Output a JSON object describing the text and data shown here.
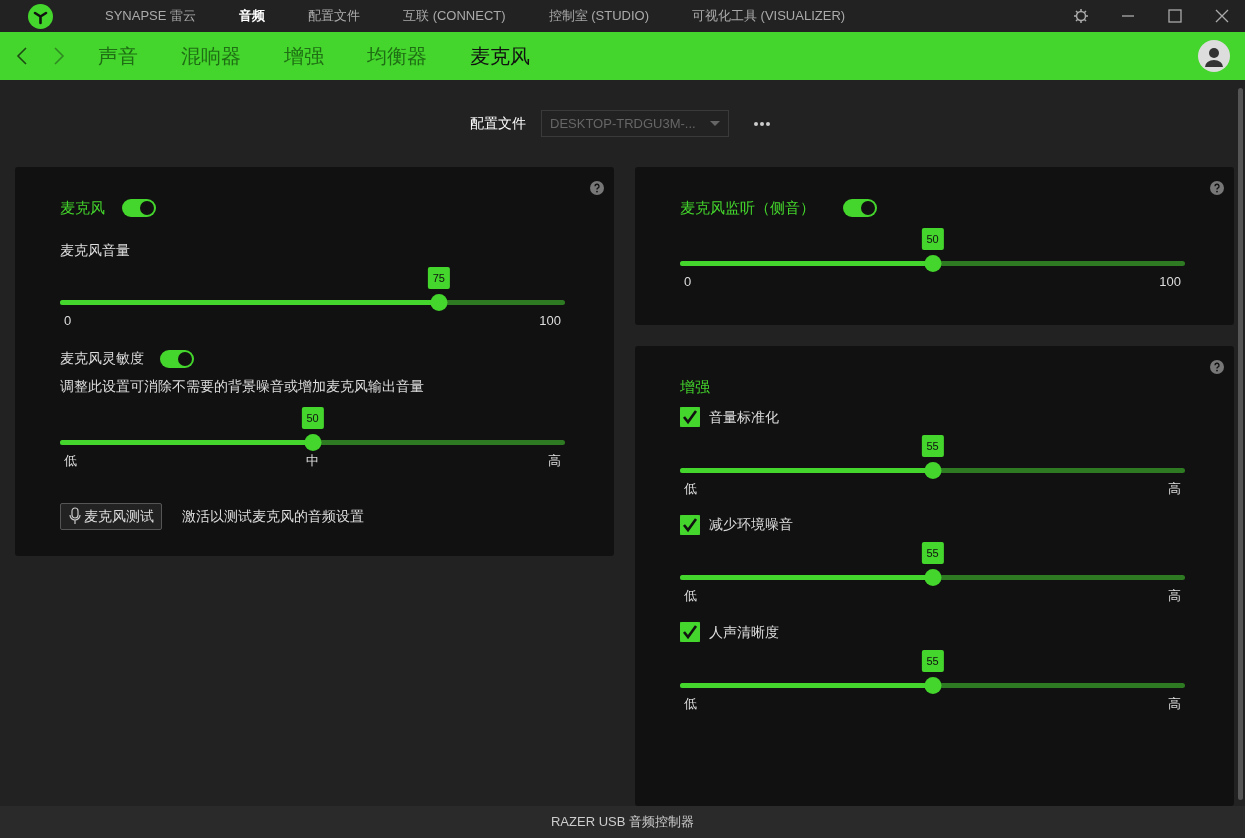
{
  "top_nav": [
    {
      "label": "SYNAPSE 雷云",
      "selected": false
    },
    {
      "label": "音频",
      "selected": true
    },
    {
      "label": "配置文件",
      "selected": false
    },
    {
      "label": "互联 (CONNECT)",
      "selected": false
    },
    {
      "label": "控制室 (STUDIO)",
      "selected": false
    },
    {
      "label": "可视化工具 (VISUALIZER)",
      "selected": false
    }
  ],
  "sub_nav": [
    {
      "label": "声音",
      "selected": false
    },
    {
      "label": "混响器",
      "selected": false
    },
    {
      "label": "增强",
      "selected": false
    },
    {
      "label": "均衡器",
      "selected": false
    },
    {
      "label": "麦克风",
      "selected": true
    }
  ],
  "profile": {
    "label": "配置文件",
    "value": "DESKTOP-TRDGU3M-..."
  },
  "microphone": {
    "title": "麦克风",
    "on": true,
    "volume": {
      "label": "麦克风音量",
      "value": "75",
      "level": 0.75,
      "ticks": [
        "0",
        "100"
      ]
    },
    "sensitivity": {
      "label": "麦克风灵敏度",
      "on": true,
      "description": "调整此设置可消除不需要的背景噪音或增加麦克风输出音量",
      "value": "50",
      "level": 0.5,
      "ticks": [
        "低",
        "中",
        "高"
      ]
    },
    "test_button": "麦克风测试",
    "test_hint": "激活以测试麦克风的音频设置"
  },
  "sidetone": {
    "title": "麦克风监听（侧音）",
    "on": true,
    "value": "50",
    "level": 0.5,
    "ticks": [
      "0",
      "100"
    ]
  },
  "enhancement": {
    "title": "增强",
    "items": [
      {
        "label": "音量标准化",
        "checked": true,
        "value": "55",
        "level": 0.5,
        "ticks": [
          "低",
          "高"
        ]
      },
      {
        "label": "减少环境噪音",
        "checked": true,
        "value": "55",
        "level": 0.5,
        "ticks": [
          "低",
          "高"
        ]
      },
      {
        "label": "人声清晰度",
        "checked": true,
        "value": "55",
        "level": 0.5,
        "ticks": [
          "低",
          "高"
        ]
      }
    ]
  },
  "footer": "RAZER USB 音频控制器"
}
